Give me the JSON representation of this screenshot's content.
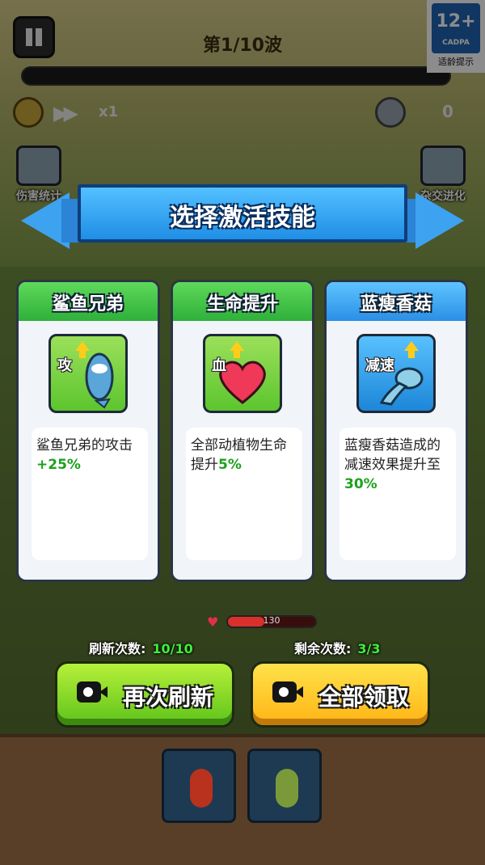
{
  "hud": {
    "wave_label": "第1/10波",
    "speed_multiplier": "x1",
    "coin_count": "0",
    "damage_stats_label": "伤害统计",
    "hybrid_evolution_label": "杂交进化"
  },
  "age_rating": {
    "age": "12+",
    "org": "CADPA",
    "tip": "适龄提示"
  },
  "dialog": {
    "title": "选择激活技能",
    "cards": [
      {
        "name": "鲨鱼兄弟",
        "icon": "shark-icon",
        "tag": "攻",
        "desc_prefix": "鲨鱼兄弟的攻击",
        "desc_value": "+25%",
        "desc_suffix": "",
        "theme": "#2fb03a"
      },
      {
        "name": "生命提升",
        "icon": "heart-icon",
        "tag": "血",
        "desc_prefix": "全部动植物生命提升",
        "desc_value": "5%",
        "desc_suffix": "",
        "theme": "#2fb03a"
      },
      {
        "name": "蓝瘦香菇",
        "icon": "mushroom-icon",
        "tag": "减速",
        "desc_prefix": "蓝瘦香菇造成的减速效果提升至",
        "desc_value": "30%",
        "desc_suffix": "",
        "theme": "#2a8fe6"
      }
    ]
  },
  "base_hp": {
    "value": "130",
    "fraction": 0.42
  },
  "counters": {
    "refresh_label": "刷新次数:",
    "refresh_value": "10/10",
    "remaining_label": "剩余次数:",
    "remaining_value": "3/3"
  },
  "buttons": {
    "refresh": "再次刷新",
    "claim_all": "全部领取"
  },
  "plant_slots": [
    {
      "icon": "chili-pepper-icon"
    },
    {
      "icon": "squash-icon"
    }
  ]
}
